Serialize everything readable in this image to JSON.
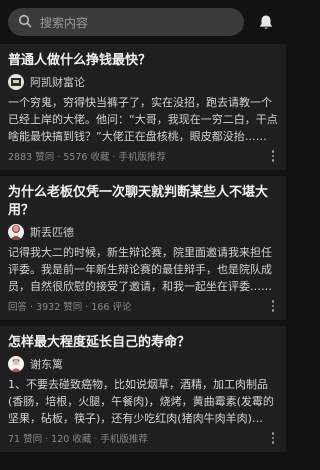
{
  "search": {
    "placeholder": "搜索内容",
    "icon": "search-icon"
  },
  "header": {
    "bell_icon": "bell-icon"
  },
  "cards": [
    {
      "title": "普通人做什么挣钱最快？",
      "author": "阿凯财富论",
      "excerpt": "一个穷鬼，穷得快当裤子了，实在没招，跑去请教一个已经上岸的大佬。他问：“大哥，我现在一穷二白，干点啥能最快搞到钱？”大佬正在盘核桃，眼皮都没抬……",
      "meta": "2883 赞同 · 5576 收藏 · 手机版推荐"
    },
    {
      "title": "为什么老板仅凭一次聊天就判断某些人不堪大用？",
      "author": "斯丢匹德",
      "excerpt": "记得我大二的时候，新生辩论赛，院里面邀请我来担任评委。我是前一年新生辩论赛的最佳辩手，也是院队成员，自然很欣慰的接受了邀请，和我一起坐在评委……",
      "meta": "回答 · 3932 赞同 · 166 评论"
    },
    {
      "title": "怎样最大程度延长自己的寿命？",
      "author": "谢东篱",
      "excerpt": "1、不要去碰致癌物，比如说烟草，酒精，加工肉制品(香肠，培根，火腿，午餐肉)，烧烤，黄曲霉素(发霉的坚果，砧板，筷子)，还有少吃红肉(猪肉牛肉羊肉) 2……",
      "meta": "71 赞同 · 120 收藏 · 手机版推荐"
    }
  ]
}
